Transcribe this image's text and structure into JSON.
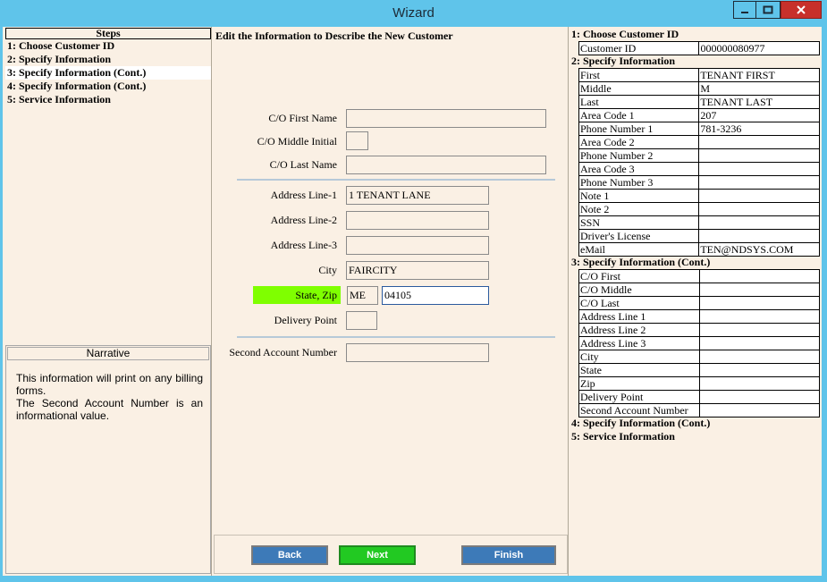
{
  "window": {
    "title": "Wizard"
  },
  "steps": {
    "header": "Steps",
    "items": [
      "1: Choose Customer ID",
      "2: Specify Information",
      "3: Specify Information (Cont.)",
      "4: Specify Information (Cont.)",
      "5: Service Information"
    ],
    "active_index": 2
  },
  "narrative": {
    "title": "Narrative",
    "text_1": "This information will print on any billing forms.",
    "text_2": "The Second Account Number is an informational value."
  },
  "form": {
    "title": "Edit the Information to Describe the New Customer",
    "co_first_name": {
      "label": "C/O First Name",
      "value": ""
    },
    "co_middle_initial": {
      "label": "C/O Middle Initial",
      "value": ""
    },
    "co_last_name": {
      "label": "C/O Last Name",
      "value": ""
    },
    "address_1": {
      "label": "Address Line-1",
      "value": "1 TENANT LANE"
    },
    "address_2": {
      "label": "Address Line-2",
      "value": ""
    },
    "address_3": {
      "label": "Address Line-3",
      "value": ""
    },
    "city": {
      "label": "City",
      "value": "FAIRCITY"
    },
    "state_zip": {
      "label": "State, Zip",
      "state": "ME",
      "zip": "04105",
      "highlight": "#7fff00"
    },
    "delivery_point": {
      "label": "Delivery Point",
      "value": ""
    },
    "second_account": {
      "label": "Second Account Number",
      "value": ""
    }
  },
  "buttons": {
    "back": "Back",
    "next": "Next",
    "finish": "Finish"
  },
  "summary": {
    "s1": {
      "title": "1: Choose Customer ID",
      "rows": [
        {
          "k": "Customer  ID",
          "v": "000000080977"
        }
      ]
    },
    "s2": {
      "title": "2: Specify Information",
      "rows": [
        {
          "k": "First",
          "v": "TENANT FIRST"
        },
        {
          "k": "Middle",
          "v": "M"
        },
        {
          "k": "Last",
          "v": "TENANT LAST"
        },
        {
          "k": "Area Code 1",
          "v": "207"
        },
        {
          "k": "Phone Number 1",
          "v": "781-3236"
        },
        {
          "k": "Area Code 2",
          "v": ""
        },
        {
          "k": "Phone Number 2",
          "v": ""
        },
        {
          "k": "Area Code 3",
          "v": ""
        },
        {
          "k": "Phone Number 3",
          "v": ""
        },
        {
          "k": "Note 1",
          "v": ""
        },
        {
          "k": "Note 2",
          "v": ""
        },
        {
          "k": "SSN",
          "v": ""
        },
        {
          "k": "Driver's License",
          "v": ""
        },
        {
          "k": "eMail",
          "v": "TEN@NDSYS.COM"
        }
      ]
    },
    "s3": {
      "title": "3: Specify Information (Cont.)",
      "rows": [
        {
          "k": "C/O First",
          "v": ""
        },
        {
          "k": "C/O Middle",
          "v": ""
        },
        {
          "k": "C/O Last",
          "v": ""
        },
        {
          "k": "Address Line 1",
          "v": ""
        },
        {
          "k": "Address Line 2",
          "v": ""
        },
        {
          "k": "Address Line 3",
          "v": ""
        },
        {
          "k": "City",
          "v": ""
        },
        {
          "k": "State",
          "v": ""
        },
        {
          "k": "Zip",
          "v": ""
        },
        {
          "k": "Delivery Point",
          "v": ""
        },
        {
          "k": "Second Account Number",
          "v": ""
        }
      ]
    },
    "s4": {
      "title": "4: Specify Information (Cont.)"
    },
    "s5": {
      "title": "5: Service Information"
    }
  }
}
